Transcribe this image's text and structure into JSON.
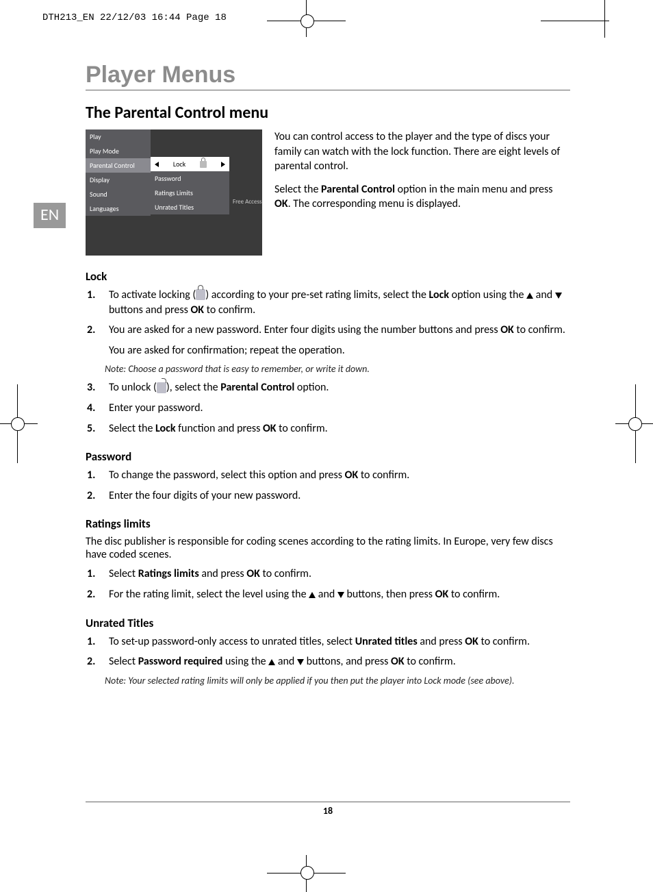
{
  "crop_header": "DTH213_EN  22/12/03  16:44  Page 18",
  "lang_tab": "EN",
  "page_number": "18",
  "title": "Player Menus",
  "section_title": "The Parental Control menu",
  "menu": {
    "left": [
      "Play",
      "Play Mode",
      "Parental Control",
      "Display",
      "Sound",
      "Languages"
    ],
    "right_sel": "Lock",
    "right": [
      "Password",
      "Ratings Limits",
      "Unrated Titles"
    ],
    "extra": "Free Access"
  },
  "intro": {
    "p1": "You can control access to the player and the type of discs your family can watch with the lock function. There are eight levels of parental control.",
    "p2a": "Select the ",
    "p2b": "Parental Control",
    "p2c": " option in the main menu and press ",
    "p2d": "OK",
    "p2e": ". The corresponding menu is displayed."
  },
  "lock": {
    "h": "Lock",
    "s1a": "To activate locking (",
    "s1b": ") according to your pre-set rating limits, select the ",
    "s1c": "Lock",
    "s1d": " option using the ",
    "s1e": " and ",
    "s1f": " buttons and press ",
    "s1g": "OK",
    "s1h": " to confirm.",
    "s2a": "You are asked for a new password. Enter four digits using the number buttons and press ",
    "s2b": "OK",
    "s2c": " to confirm.",
    "sub": "You are asked for confirmation; repeat the operation.",
    "note": "Note: Choose a password that is easy to remember, or write it down.",
    "s3a": "To unlock (",
    "s3b": "), select the ",
    "s3c": "Parental Control",
    "s3d": " option.",
    "s4": "Enter your password.",
    "s5a": "Select the ",
    "s5b": "Lock",
    "s5c": " function and press ",
    "s5d": "OK",
    "s5e": " to confirm."
  },
  "password": {
    "h": "Password",
    "s1a": "To change the password, select this option and press ",
    "s1b": "OK",
    "s1c": " to confirm.",
    "s2": "Enter the four digits of your new password."
  },
  "ratings": {
    "h": "Ratings limits",
    "p": "The disc publisher is responsible for coding scenes according to the rating limits. In Europe, very few discs have coded scenes.",
    "s1a": "Select ",
    "s1b": "Ratings limits",
    "s1c": " and press ",
    "s1d": "OK",
    "s1e": " to confirm.",
    "s2a": "For the rating limit, select the level using the ",
    "s2b": " and ",
    "s2c": " buttons, then press ",
    "s2d": "OK",
    "s2e": " to confirm."
  },
  "unrated": {
    "h": "Unrated Titles",
    "s1a": "To set-up password-only access to unrated titles, select ",
    "s1b": "Unrated titles",
    "s1c": " and press ",
    "s1d": "OK",
    "s1e": " to confirm.",
    "s2a": "Select ",
    "s2b": "Password required",
    "s2c": " using the ",
    "s2d": " and ",
    "s2e": " buttons, and press ",
    "s2f": "OK",
    "s2g": " to confirm.",
    "note": "Note: Your selected rating limits will only be applied if you then put the player into Lock mode (see above)."
  }
}
